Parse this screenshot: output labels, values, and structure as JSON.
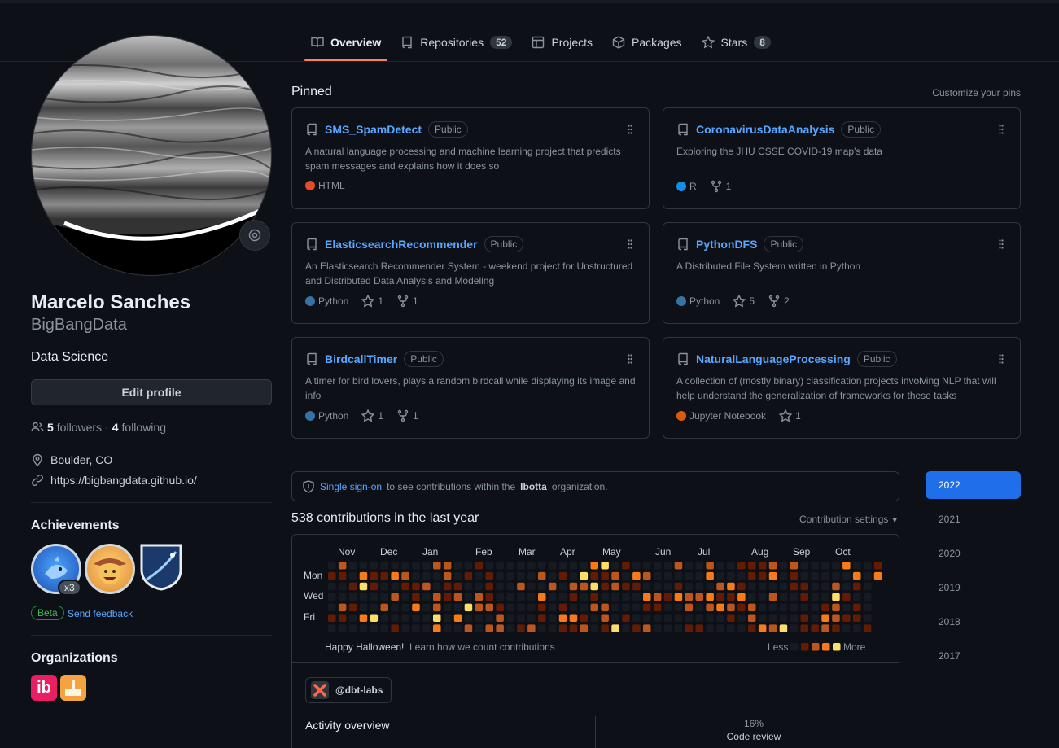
{
  "tabs": [
    {
      "label": "Overview",
      "icon": "book-icon"
    },
    {
      "label": "Repositories",
      "count": "52",
      "icon": "repo-icon"
    },
    {
      "label": "Projects",
      "icon": "table-icon"
    },
    {
      "label": "Packages",
      "icon": "package-icon"
    },
    {
      "label": "Stars",
      "count": "8",
      "icon": "star-icon"
    }
  ],
  "profile": {
    "name": "Marcelo Sanches",
    "login": "BigBangData",
    "bio": "Data Science",
    "edit_label": "Edit profile",
    "followers": "5",
    "followers_label": "followers",
    "following": "4",
    "following_label": "following",
    "dot": "·",
    "location": "Boulder, CO",
    "website": "https://bigbangdata.github.io/"
  },
  "achievements": {
    "heading": "Achievements",
    "count_badge": "x3",
    "beta": "Beta",
    "feedback": "Send feedback"
  },
  "organizations": {
    "heading": "Organizations",
    "ibotta_text": "ib"
  },
  "pinned": {
    "heading": "Pinned",
    "customize": "Customize your pins",
    "items": [
      {
        "title": "SMS_SpamDetect",
        "visibility": "Public",
        "desc": "A natural language processing and machine learning project that predicts spam messages and explains how it does so",
        "lang": "HTML",
        "lang_color": "#e34c26",
        "stars": "",
        "forks": ""
      },
      {
        "title": "CoronavirusDataAnalysis",
        "visibility": "Public",
        "desc": "Exploring the JHU CSSE COVID-19 map's data",
        "lang": "R",
        "lang_color": "#198ce7",
        "stars": "",
        "forks": "1"
      },
      {
        "title": "ElasticsearchRecommender",
        "visibility": "Public",
        "desc": "An Elasticsearch Recommender System - weekend project for Unstructured and Distributed Data Analysis and Modeling",
        "lang": "Python",
        "lang_color": "#3572A5",
        "stars": "1",
        "forks": "1"
      },
      {
        "title": "PythonDFS",
        "visibility": "Public",
        "desc": "A Distributed File System written in Python",
        "lang": "Python",
        "lang_color": "#3572A5",
        "stars": "5",
        "forks": "2"
      },
      {
        "title": "BirdcallTimer",
        "visibility": "Public",
        "desc": "A timer for bird lovers, plays a random birdcall while displaying its image and info",
        "lang": "Python",
        "lang_color": "#3572A5",
        "stars": "1",
        "forks": "1"
      },
      {
        "title": "NaturalLanguageProcessing",
        "visibility": "Public",
        "desc": "A collection of (mostly binary) classification projects involving NLP that will help understand the generalization of frameworks for these tasks",
        "lang": "Jupyter Notebook",
        "lang_color": "#DA5B0B",
        "stars": "1",
        "forks": ""
      }
    ]
  },
  "sso": {
    "link": "Single sign-on",
    "text_before": "to see contributions within the",
    "org": "Ibotta",
    "text_after": "organization."
  },
  "contributions": {
    "heading": "538 contributions in the last year",
    "settings": "Contribution settings",
    "months": [
      "Nov",
      "Dec",
      "Jan",
      "Feb",
      "Mar",
      "Apr",
      "May",
      "Jun",
      "Jul",
      "Aug",
      "Sep",
      "Oct"
    ],
    "days": [
      "Mon",
      "Wed",
      "Fri"
    ],
    "footer_left": "Happy Halloween!",
    "footer_link": "Learn how we count contributions",
    "less": "Less",
    "more": "More",
    "palette": [
      "#161b22",
      "#631c03",
      "#bd561d",
      "#fa7a18",
      "#fddf68"
    ]
  },
  "activity": {
    "org_chip": "@dbt-labs",
    "heading": "Activity overview",
    "pct": "16%",
    "label": "Code review"
  },
  "years": [
    "2022",
    "2021",
    "2020",
    "2019",
    "2018",
    "2017"
  ]
}
